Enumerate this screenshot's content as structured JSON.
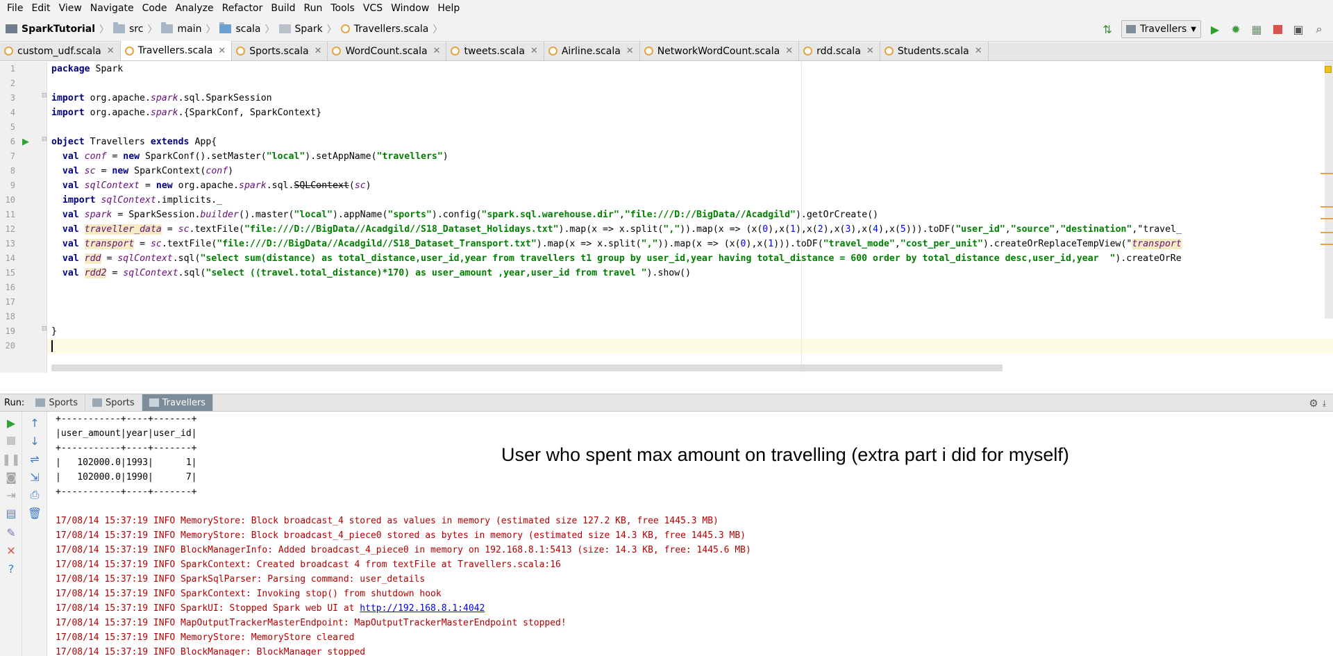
{
  "menu": [
    "File",
    "Edit",
    "View",
    "Navigate",
    "Code",
    "Analyze",
    "Refactor",
    "Build",
    "Run",
    "Tools",
    "VCS",
    "Window",
    "Help"
  ],
  "breadcrumbs": [
    "SparkTutorial",
    "src",
    "main",
    "scala",
    "Spark",
    "Travellers.scala"
  ],
  "run_config": "Travellers",
  "tabs": [
    "custom_udf.scala",
    "Travellers.scala",
    "Sports.scala",
    "WordCount.scala",
    "tweets.scala",
    "Airline.scala",
    "NetworkWordCount.scala",
    "rdd.scala",
    "Students.scala"
  ],
  "active_tab": "Travellers.scala",
  "line_numbers": [
    "1",
    "2",
    "3",
    "4",
    "5",
    "6",
    "7",
    "8",
    "9",
    "10",
    "11",
    "12",
    "13",
    "14",
    "15",
    "16",
    "17",
    "18",
    "19",
    "20"
  ],
  "code_lines": [
    "package Spark",
    "",
    "import org.apache.spark.sql.SparkSession",
    "import org.apache.spark.{SparkConf, SparkContext}",
    "",
    "object Travellers extends App{",
    "  val conf = new SparkConf().setMaster(\"local\").setAppName(\"travellers\")",
    "  val sc = new SparkContext(conf)",
    "  val sqlContext = new org.apache.spark.sql.SQLContext(sc)",
    "  import sqlContext.implicits._",
    "  val spark = SparkSession.builder().master(\"local\").appName(\"sports\").config(\"spark.sql.warehouse.dir\",\"file:///D://BigData//Acadgild\").getOrCreate()",
    "  val traveller_data = sc.textFile(\"file:///D://BigData//Acadgild//S18_Dataset_Holidays.txt\").map(x => x.split(\",\")).map(x => (x(0),x(1),x(2),x(3),x(4),x(5))).toDF(\"user_id\",\"source\",\"destination\",\"travel_",
    "  val transport = sc.textFile(\"file:///D://BigData//Acadgild//S18_Dataset_Transport.txt\").map(x => x.split(\",\")).map(x => (x(0),x(1))).toDF(\"travel_mode\",\"cost_per_unit\").createOrReplaceTempView(\"transport",
    "  val rdd = sqlContext.sql(\"select sum(distance) as total_distance,user_id,year from travellers t1 group by user_id,year having total_distance = 600 order by total_distance desc,user_id,year  \").createOrRe",
    "  val rdd2 = sqlContext.sql(\"select ((travel.total_distance)*170) as user_amount ,year,user_id from travel \").show()",
    "",
    "",
    "",
    "}",
    ""
  ],
  "run": {
    "label": "Run:",
    "tabs": [
      "Sports",
      "Sports",
      "Travellers"
    ],
    "active_tab": "Travellers"
  },
  "console": {
    "table_lines": [
      "+-----------+----+-------+",
      "|user_amount|year|user_id|",
      "+-----------+----+-------+",
      "|   102000.0|1993|      1|",
      "|   102000.0|1990|      7|",
      "+-----------+----+-------+"
    ],
    "log_lines": [
      "17/08/14 15:37:19 INFO MemoryStore: Block broadcast_4 stored as values in memory (estimated size 127.2 KB, free 1445.3 MB)",
      "17/08/14 15:37:19 INFO MemoryStore: Block broadcast_4_piece0 stored as bytes in memory (estimated size 14.3 KB, free 1445.3 MB)",
      "17/08/14 15:37:19 INFO BlockManagerInfo: Added broadcast_4_piece0 in memory on 192.168.8.1:5413 (size: 14.3 KB, free: 1445.6 MB)",
      "17/08/14 15:37:19 INFO SparkContext: Created broadcast 4 from textFile at Travellers.scala:16",
      "17/08/14 15:37:19 INFO SparkSqlParser: Parsing command: user_details",
      "17/08/14 15:37:19 INFO SparkContext: Invoking stop() from shutdown hook",
      "17/08/14 15:37:19 INFO SparkUI: Stopped Spark web UI at ",
      "17/08/14 15:37:19 INFO MapOutputTrackerMasterEndpoint: MapOutputTrackerMasterEndpoint stopped!",
      "17/08/14 15:37:19 INFO MemoryStore: MemoryStore cleared",
      "17/08/14 15:37:19 INFO BlockManager: BlockManager stopped"
    ],
    "sparkui_link": "http://192.168.8.1:4042"
  },
  "annotation": "User who spent max amount on travelling (extra part i did for myself)",
  "colors": {
    "keyword": "#000080",
    "string": "#008000",
    "number": "#0000ff",
    "italic_var": "#660e7a",
    "log_red": "#b40000",
    "run_tab_active": "#7c8c99"
  }
}
